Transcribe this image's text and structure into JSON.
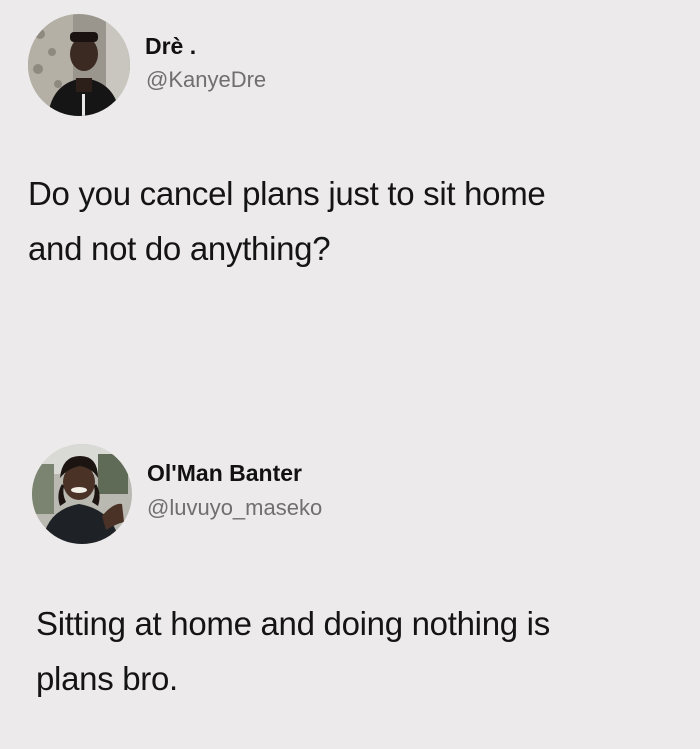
{
  "posts": [
    {
      "display_name": "Drè .",
      "handle": "@KanyeDre",
      "text_lines": [
        "Do you cancel plans just to sit home",
        "and not do anything?"
      ],
      "avatar_icon": "profile-photo-icon"
    },
    {
      "display_name": "Ol'Man Banter",
      "handle": "@luvuyo_maseko",
      "text_lines": [
        "Sitting at home and doing nothing is",
        "plans bro."
      ],
      "avatar_icon": "profile-photo-icon"
    }
  ],
  "colors": {
    "background": "#eceaeb",
    "name": "#111111",
    "handle": "#6f6f6f",
    "text": "#141414"
  }
}
